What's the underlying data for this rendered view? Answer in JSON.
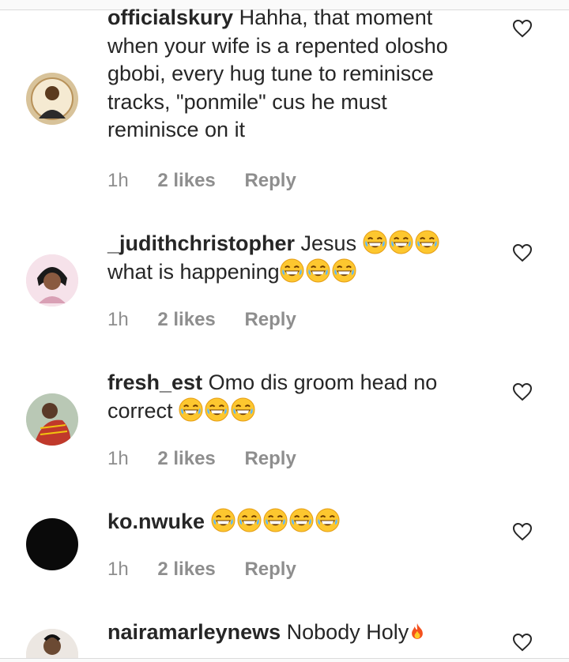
{
  "comments": [
    {
      "username": "officialskury",
      "text": "Hahha, that moment when your wife is a repented olosho gbobi, every hug tune to reminisce tracks, \"ponmile\" cus he must reminisce on it",
      "time": "1h",
      "likes": "2 likes",
      "reply": "Reply",
      "emojis": 0
    },
    {
      "username": "_judithchristopher",
      "text": "Jesus",
      "text2": "what is happening",
      "time": "1h",
      "likes": "2 likes",
      "reply": "Reply",
      "emojis": 6
    },
    {
      "username": "fresh_est",
      "text": "Omo dis groom head no correct",
      "time": "1h",
      "likes": "2 likes",
      "reply": "Reply",
      "emojis": 3
    },
    {
      "username": "ko.nwuke",
      "text": "",
      "time": "1h",
      "likes": "2 likes",
      "reply": "Reply",
      "emojis": 5
    },
    {
      "username": "nairamarleynews",
      "text": "Nobody Holy",
      "emoji_icon": "fire-emoji"
    }
  ],
  "colors": {
    "text": "#262626",
    "meta": "#8e8e8e",
    "emoji": "#fdc72f"
  }
}
